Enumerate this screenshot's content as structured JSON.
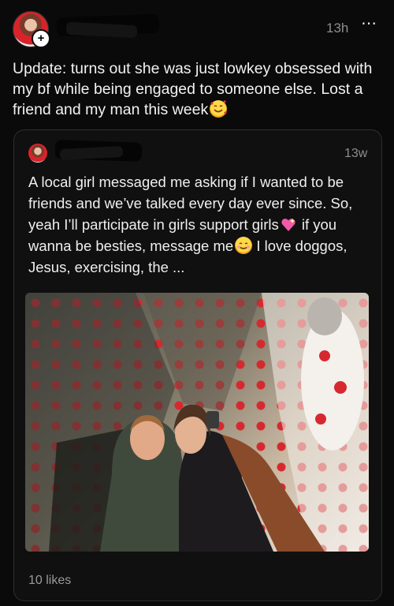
{
  "post": {
    "time": "13h",
    "more_icon": "⋯",
    "plus_badge": "+",
    "text": "Update: turns out she was just lowkey obsessed with my bf while being engaged to someone else. Lost a friend and my man this week"
  },
  "quoted": {
    "time": "13w",
    "text_part1": "A local girl messaged me asking if I wanted to be friends and we’ve talked every day ever since. So, yeah I’ll participate in girls support girls",
    "text_part2": " if you wanna be besties, message me",
    "text_part3": " I love doggos, Jesus, exercising, the ...",
    "likes": "10 likes"
  },
  "colors": {
    "background": "#0a0a0a",
    "card_border": "#2e2e2e",
    "muted_text": "#8e8e8e",
    "polka_red": "#d6292f"
  },
  "icons": {
    "more": "more-icon",
    "emoji_1": "smiling-face-with-hearts-emoji",
    "emoji_2": "sparkling-heart-emoji",
    "emoji_3": "smiling-face-emoji"
  }
}
